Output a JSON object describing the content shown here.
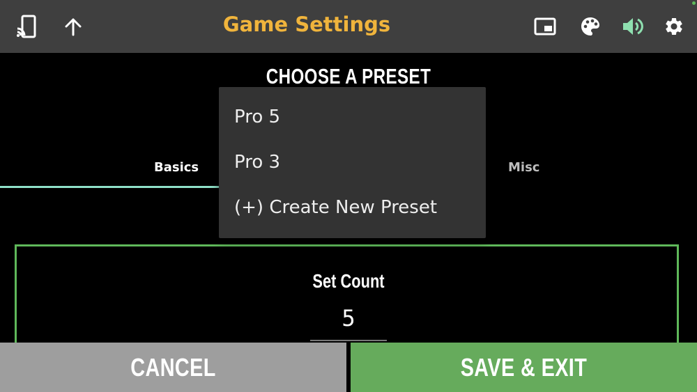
{
  "header": {
    "title": "Game Settings",
    "icons": [
      "cast-icon",
      "arrow-up-icon",
      "picture-in-picture-icon",
      "palette-icon",
      "volume-icon",
      "gear-icon"
    ],
    "title_color": "#f0b43c",
    "volume_color": "#8fe0b0"
  },
  "main": {
    "preset_heading": "CHOOSE A PRESET",
    "tabs": [
      {
        "label": "Basics",
        "active": true
      },
      {
        "label": "Misc",
        "active": false
      }
    ],
    "card": {
      "label": "Set Count",
      "value": "5",
      "border_color": "#5fb85a"
    }
  },
  "dropdown": {
    "options": [
      {
        "label": "Pro 5"
      },
      {
        "label": "Pro 3"
      },
      {
        "label": "(+) Create New Preset"
      }
    ]
  },
  "footer": {
    "cancel_label": "CANCEL",
    "save_label": "SAVE & EXIT",
    "cancel_color": "#9e9e9e",
    "save_color": "#66ab5c"
  }
}
